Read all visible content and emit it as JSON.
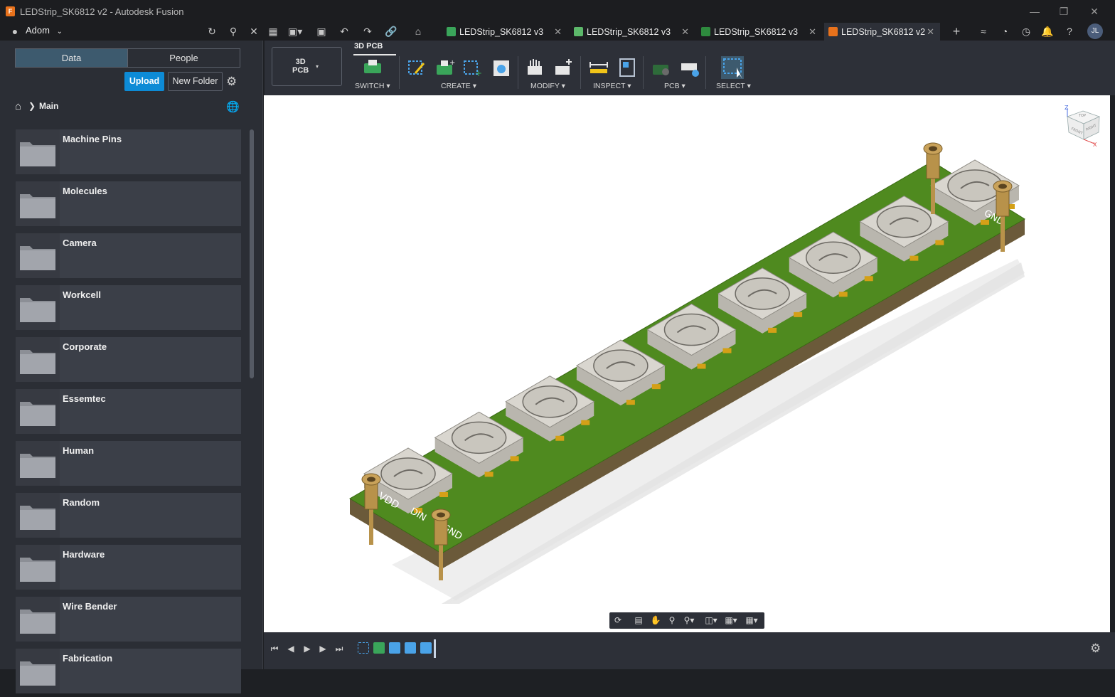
{
  "window": {
    "title": "LEDStrip_SK6812 v2 - Autodesk Fusion",
    "app_icon": "F"
  },
  "account": {
    "team": "Adom",
    "user_initials": "JL"
  },
  "tabs": [
    {
      "label": "LEDStrip_SK6812 v3",
      "kind": "pcb-schematic",
      "active": false
    },
    {
      "label": "LEDStrip_SK6812 v3",
      "kind": "schematic",
      "active": false
    },
    {
      "label": "LEDStrip_SK6812 v3",
      "kind": "pcb",
      "active": false
    },
    {
      "label": "LEDStrip_SK6812 v2",
      "kind": "3d-pcb",
      "active": true
    }
  ],
  "data_panel": {
    "segments": {
      "data": "Data",
      "people": "People"
    },
    "upload": "Upload",
    "new_folder": "New Folder",
    "breadcrumb": {
      "current": "Main"
    },
    "folders": [
      "Machine Pins",
      "Molecules",
      "Camera",
      "Workcell",
      "Corporate",
      "Essemtec",
      "Human",
      "Random",
      "Hardware",
      "Wire Bender",
      "Fabrication"
    ]
  },
  "toolbar": {
    "workspace": {
      "line1": "3D",
      "line2": "PCB"
    },
    "workspace_tab": "3D PCB",
    "groups": {
      "switch": "SWITCH",
      "create": "CREATE",
      "modify": "MODIFY",
      "inspect": "INSPECT",
      "pcb": "PCB",
      "select": "SELECT"
    }
  },
  "board": {
    "silkscreen": {
      "vdd": "VDD",
      "din": "DIN",
      "gnd": "GND"
    },
    "led_count": 9,
    "colors": {
      "pcb": "#4f8a1f",
      "substrate": "#6b5a3a",
      "led_body": "#d9d6cf",
      "pad": "#d4a017",
      "pin": "#b8924a"
    }
  },
  "viewcube": {
    "top": "TOP",
    "front": "FRONT",
    "right": "RIGHT",
    "axis_z": "Z",
    "axis_x": "X"
  },
  "colors": {
    "accent": "#0d8bd6",
    "titlebar": "#1c1d20",
    "panel": "#2b2e35",
    "toolbar": "#2d3038",
    "folder": "#3b3f48"
  }
}
